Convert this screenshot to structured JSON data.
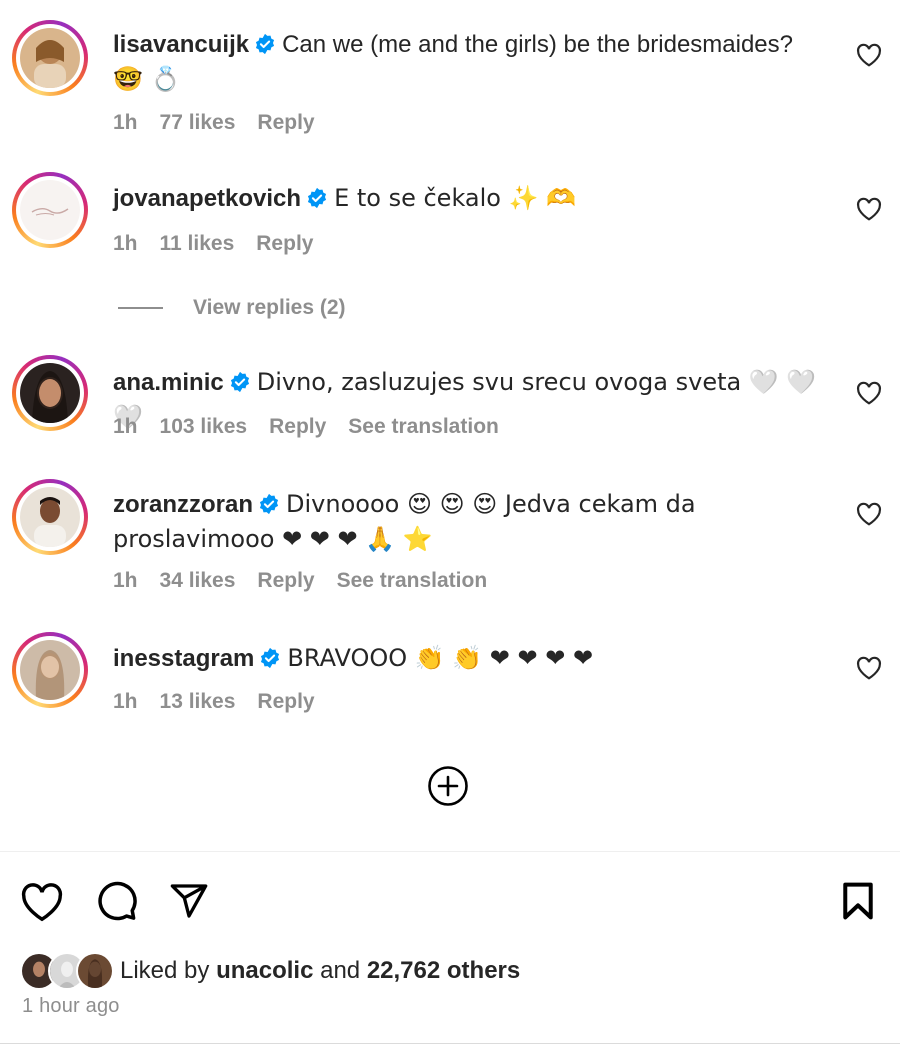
{
  "comments": [
    {
      "username": "lisavancuijk",
      "text": "Can we (me and the girls) be the bridesmaides?",
      "text2": "🤓 💍",
      "time": "1h",
      "likes": "77 likes",
      "reply": "Reply"
    },
    {
      "username": "jovanapetkovich",
      "text": "E to se čekalo ✨ 🫶",
      "time": "1h",
      "likes": "11 likes",
      "reply": "Reply"
    },
    {
      "username": "ana.minic",
      "text": "Divno, zasluzujes svu srecu ovoga sveta 🤍 🤍 🤍",
      "time": "1h",
      "likes": "103 likes",
      "reply": "Reply",
      "translate": "See translation"
    },
    {
      "username": "zoranzzoran",
      "text": "Divnoooo 😍 😍 😍 Jedva cekam da",
      "text2": "proslavimooo ❤ ❤ ❤ 🙏 ⭐",
      "time": "1h",
      "likes": "34 likes",
      "reply": "Reply",
      "translate": "See translation"
    },
    {
      "username": "inesstagram",
      "text": "BRAVOOO 👏 👏 ❤ ❤ ❤ ❤",
      "time": "1h",
      "likes": "13 likes",
      "reply": "Reply"
    }
  ],
  "view_replies": "View replies (2)",
  "actions": {
    "like_icon": "heart-outline-icon",
    "comment_icon": "comment-bubble-icon",
    "share_icon": "paper-plane-icon",
    "save_icon": "bookmark-icon",
    "add_icon": "plus-circle-icon"
  },
  "liked_by": {
    "prefix": "Liked by",
    "user": "unacolic",
    "middle": "and",
    "count": "22,762 others"
  },
  "timestamp": "1 hour ago",
  "colors": {
    "text": "#262626",
    "muted": "#8e8e8e",
    "verified": "#0095f6",
    "ring_start": "#feda75",
    "ring_end": "#d62976"
  }
}
